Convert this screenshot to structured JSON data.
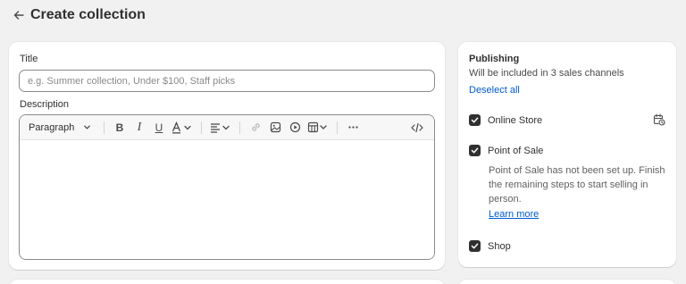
{
  "header": {
    "title": "Create collection"
  },
  "form": {
    "title_label": "Title",
    "title_placeholder": "e.g. Summer collection, Under $100, Staff picks",
    "description_label": "Description",
    "toolbar": {
      "format_select": "Paragraph"
    }
  },
  "publishing": {
    "title": "Publishing",
    "subtitle": "Will be included in 3 sales channels",
    "deselect_all": "Deselect all",
    "channels": [
      {
        "label": "Online Store",
        "checked": true
      },
      {
        "label": "Point of Sale",
        "checked": true,
        "note": "Point of Sale has not been set up. Finish the remaining steps to start selling in person.",
        "link": "Learn more"
      },
      {
        "label": "Shop",
        "checked": true
      }
    ]
  },
  "colors": {
    "link": "#005bd3",
    "checkbox": "#303030",
    "background": "#f1f1f1"
  }
}
